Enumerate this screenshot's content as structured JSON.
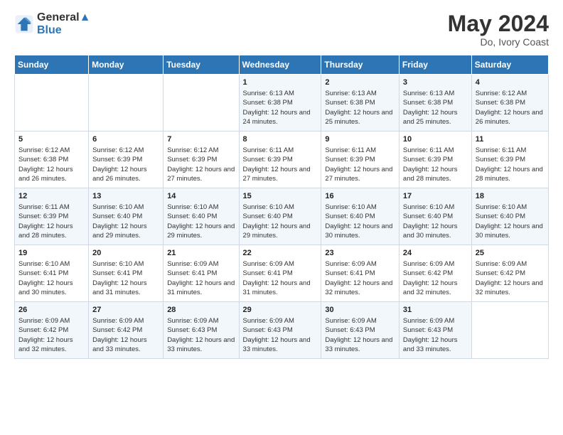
{
  "header": {
    "logo_line1": "General",
    "logo_line2": "Blue",
    "month": "May 2024",
    "location": "Do, Ivory Coast"
  },
  "weekdays": [
    "Sunday",
    "Monday",
    "Tuesday",
    "Wednesday",
    "Thursday",
    "Friday",
    "Saturday"
  ],
  "weeks": [
    [
      {
        "day": "",
        "info": ""
      },
      {
        "day": "",
        "info": ""
      },
      {
        "day": "",
        "info": ""
      },
      {
        "day": "1",
        "info": "Sunrise: 6:13 AM\nSunset: 6:38 PM\nDaylight: 12 hours and 24 minutes."
      },
      {
        "day": "2",
        "info": "Sunrise: 6:13 AM\nSunset: 6:38 PM\nDaylight: 12 hours and 25 minutes."
      },
      {
        "day": "3",
        "info": "Sunrise: 6:13 AM\nSunset: 6:38 PM\nDaylight: 12 hours and 25 minutes."
      },
      {
        "day": "4",
        "info": "Sunrise: 6:12 AM\nSunset: 6:38 PM\nDaylight: 12 hours and 26 minutes."
      }
    ],
    [
      {
        "day": "5",
        "info": "Sunrise: 6:12 AM\nSunset: 6:38 PM\nDaylight: 12 hours and 26 minutes."
      },
      {
        "day": "6",
        "info": "Sunrise: 6:12 AM\nSunset: 6:39 PM\nDaylight: 12 hours and 26 minutes."
      },
      {
        "day": "7",
        "info": "Sunrise: 6:12 AM\nSunset: 6:39 PM\nDaylight: 12 hours and 27 minutes."
      },
      {
        "day": "8",
        "info": "Sunrise: 6:11 AM\nSunset: 6:39 PM\nDaylight: 12 hours and 27 minutes."
      },
      {
        "day": "9",
        "info": "Sunrise: 6:11 AM\nSunset: 6:39 PM\nDaylight: 12 hours and 27 minutes."
      },
      {
        "day": "10",
        "info": "Sunrise: 6:11 AM\nSunset: 6:39 PM\nDaylight: 12 hours and 28 minutes."
      },
      {
        "day": "11",
        "info": "Sunrise: 6:11 AM\nSunset: 6:39 PM\nDaylight: 12 hours and 28 minutes."
      }
    ],
    [
      {
        "day": "12",
        "info": "Sunrise: 6:11 AM\nSunset: 6:39 PM\nDaylight: 12 hours and 28 minutes."
      },
      {
        "day": "13",
        "info": "Sunrise: 6:10 AM\nSunset: 6:40 PM\nDaylight: 12 hours and 29 minutes."
      },
      {
        "day": "14",
        "info": "Sunrise: 6:10 AM\nSunset: 6:40 PM\nDaylight: 12 hours and 29 minutes."
      },
      {
        "day": "15",
        "info": "Sunrise: 6:10 AM\nSunset: 6:40 PM\nDaylight: 12 hours and 29 minutes."
      },
      {
        "day": "16",
        "info": "Sunrise: 6:10 AM\nSunset: 6:40 PM\nDaylight: 12 hours and 30 minutes."
      },
      {
        "day": "17",
        "info": "Sunrise: 6:10 AM\nSunset: 6:40 PM\nDaylight: 12 hours and 30 minutes."
      },
      {
        "day": "18",
        "info": "Sunrise: 6:10 AM\nSunset: 6:40 PM\nDaylight: 12 hours and 30 minutes."
      }
    ],
    [
      {
        "day": "19",
        "info": "Sunrise: 6:10 AM\nSunset: 6:41 PM\nDaylight: 12 hours and 30 minutes."
      },
      {
        "day": "20",
        "info": "Sunrise: 6:10 AM\nSunset: 6:41 PM\nDaylight: 12 hours and 31 minutes."
      },
      {
        "day": "21",
        "info": "Sunrise: 6:09 AM\nSunset: 6:41 PM\nDaylight: 12 hours and 31 minutes."
      },
      {
        "day": "22",
        "info": "Sunrise: 6:09 AM\nSunset: 6:41 PM\nDaylight: 12 hours and 31 minutes."
      },
      {
        "day": "23",
        "info": "Sunrise: 6:09 AM\nSunset: 6:41 PM\nDaylight: 12 hours and 32 minutes."
      },
      {
        "day": "24",
        "info": "Sunrise: 6:09 AM\nSunset: 6:42 PM\nDaylight: 12 hours and 32 minutes."
      },
      {
        "day": "25",
        "info": "Sunrise: 6:09 AM\nSunset: 6:42 PM\nDaylight: 12 hours and 32 minutes."
      }
    ],
    [
      {
        "day": "26",
        "info": "Sunrise: 6:09 AM\nSunset: 6:42 PM\nDaylight: 12 hours and 32 minutes."
      },
      {
        "day": "27",
        "info": "Sunrise: 6:09 AM\nSunset: 6:42 PM\nDaylight: 12 hours and 33 minutes."
      },
      {
        "day": "28",
        "info": "Sunrise: 6:09 AM\nSunset: 6:43 PM\nDaylight: 12 hours and 33 minutes."
      },
      {
        "day": "29",
        "info": "Sunrise: 6:09 AM\nSunset: 6:43 PM\nDaylight: 12 hours and 33 minutes."
      },
      {
        "day": "30",
        "info": "Sunrise: 6:09 AM\nSunset: 6:43 PM\nDaylight: 12 hours and 33 minutes."
      },
      {
        "day": "31",
        "info": "Sunrise: 6:09 AM\nSunset: 6:43 PM\nDaylight: 12 hours and 33 minutes."
      },
      {
        "day": "",
        "info": ""
      }
    ]
  ]
}
